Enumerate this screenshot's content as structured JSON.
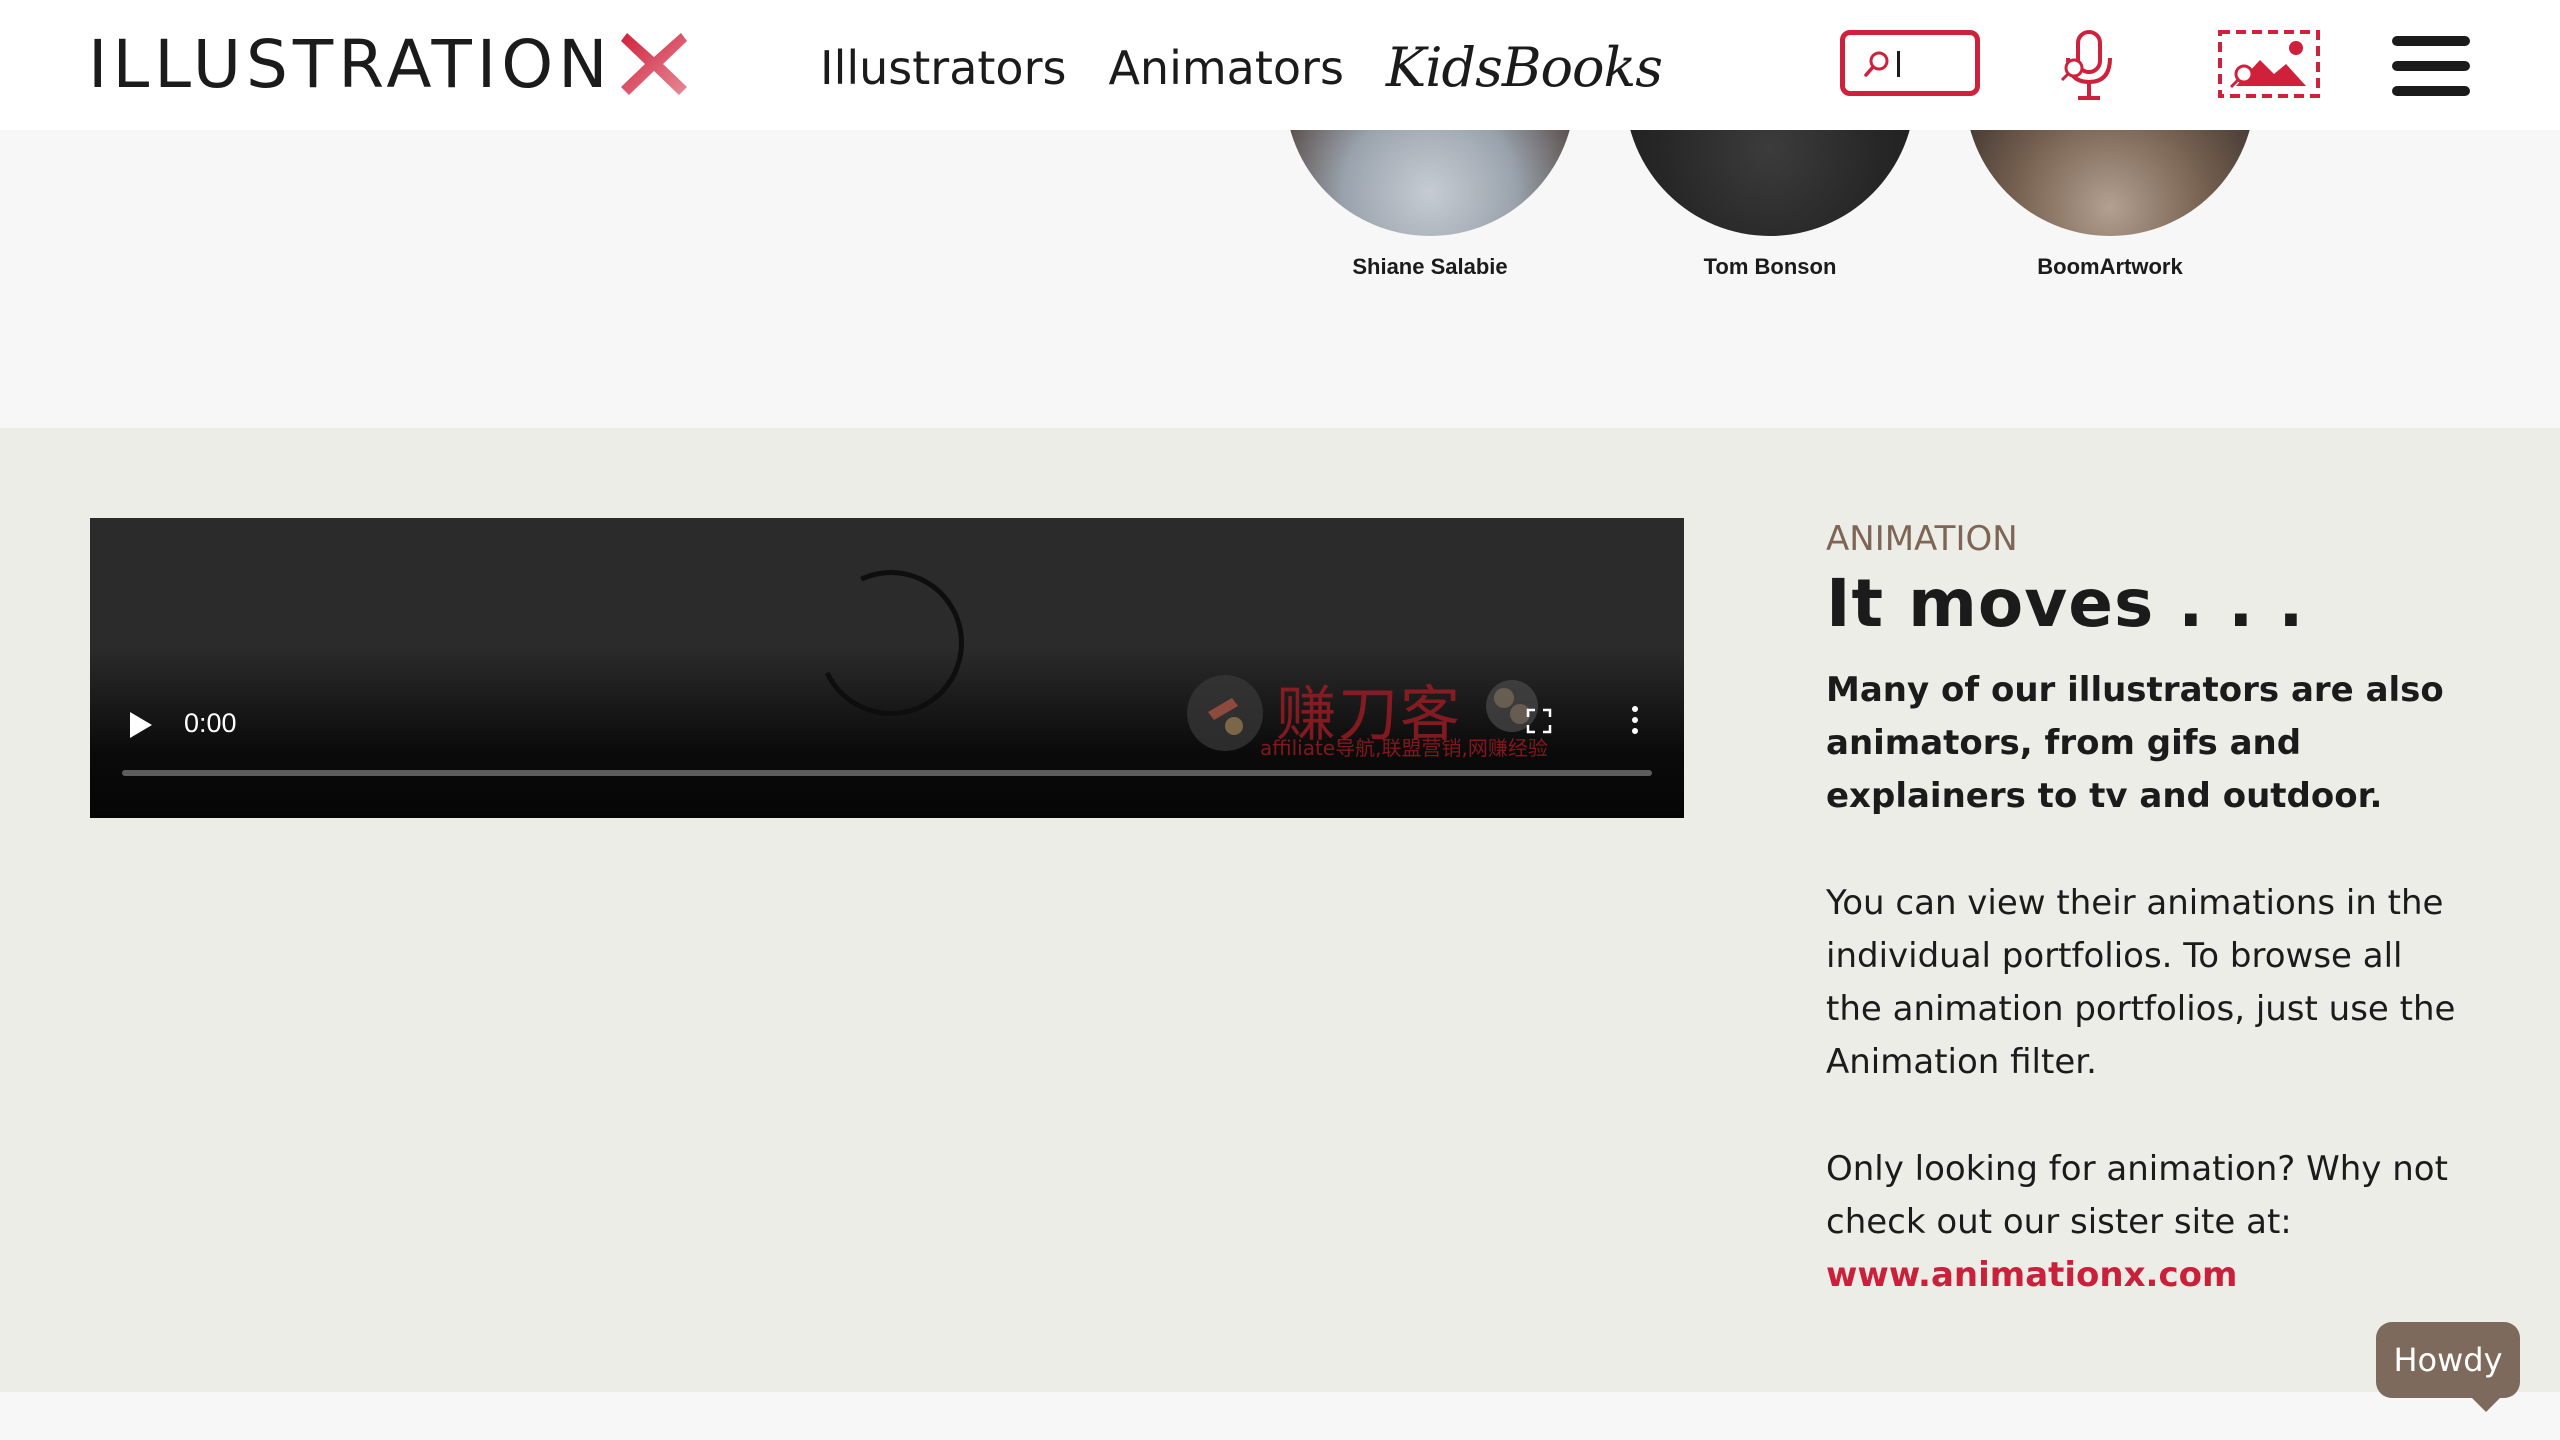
{
  "brand": {
    "logo_text": "ILLUSTRATION",
    "logo_mark": "X",
    "accent_color": "#d0213c"
  },
  "nav": {
    "items": [
      {
        "label": "Illustrators"
      },
      {
        "label": "Animators"
      },
      {
        "label": "KidsBooks"
      }
    ]
  },
  "header_icons": [
    "search-icon",
    "microphone-icon",
    "image-search-icon",
    "menu-icon"
  ],
  "artists": [
    {
      "name": "Shiane Salabie"
    },
    {
      "name": "Tom Bonson"
    },
    {
      "name": "BoomArtwork"
    }
  ],
  "video": {
    "time": "0:00",
    "progress": 0,
    "watermark_main": "赚刀客",
    "watermark_sub": "affiliate导航,联盟营销,网赚经验"
  },
  "animation_section": {
    "eyebrow": "ANIMATION",
    "headline": "It moves . . .",
    "lead": "Many of our illustrators are also animators, from gifs and explainers to tv and outdoor.",
    "para1": "You can view their animations in the individual portfolios. To browse all the animation portfolios, just use the Animation filter.",
    "para2": "Only looking for animation? Why not check out our sister site at:",
    "link": "www.animationx.com",
    "eyebrow_color": "#7e6554",
    "link_color": "#c9213a"
  },
  "chat": {
    "label": "Howdy",
    "color": "#7e6a5c"
  }
}
